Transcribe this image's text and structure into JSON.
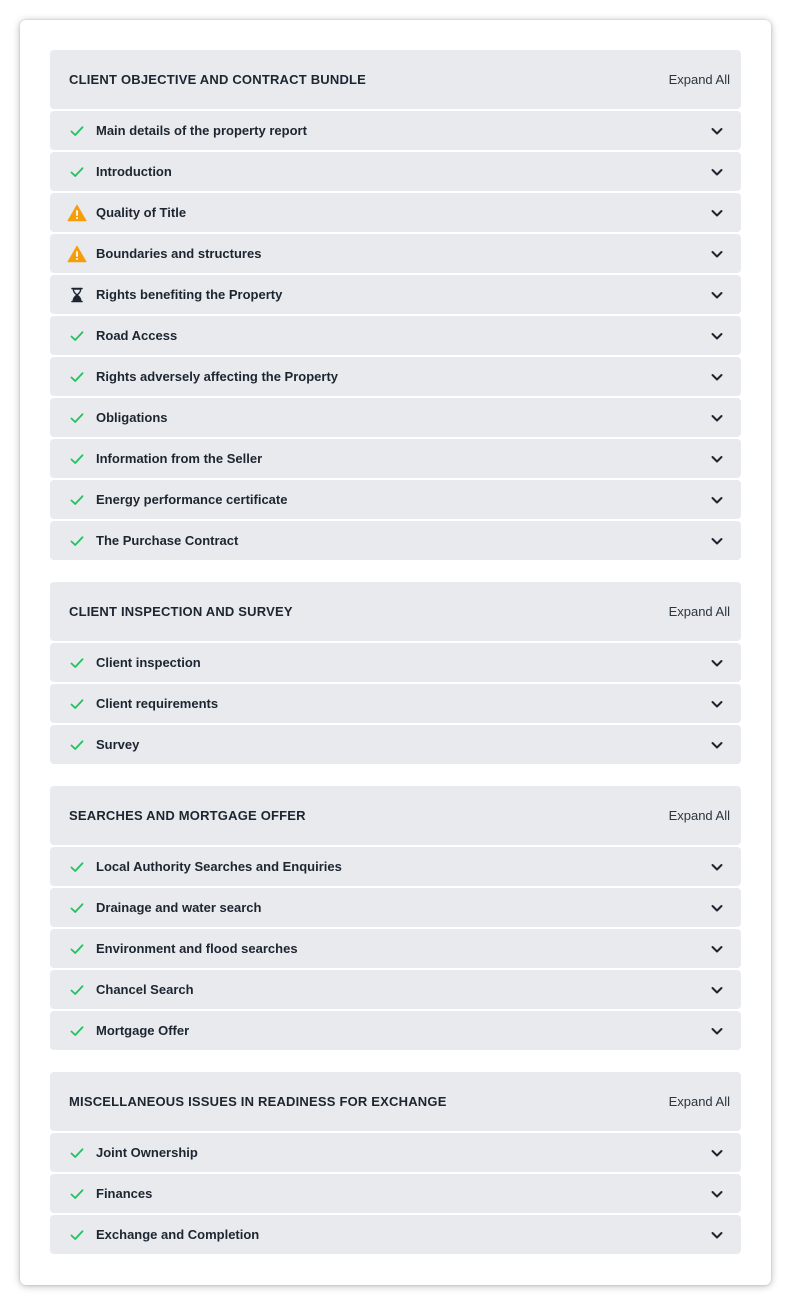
{
  "colors": {
    "check": "#22c35e",
    "warning": "#f59e0b",
    "pending": "#1c2530",
    "row_bg": "#e8eaee"
  },
  "sections": [
    {
      "title": "CLIENT OBJECTIVE AND CONTRACT BUNDLE",
      "expand_label": "Expand All",
      "items": [
        {
          "label": "Main details of the property report",
          "status_icon": "check-icon"
        },
        {
          "label": "Introduction",
          "status_icon": "check-icon"
        },
        {
          "label": "Quality of Title",
          "status_icon": "warning-icon"
        },
        {
          "label": "Boundaries and structures",
          "status_icon": "warning-icon"
        },
        {
          "label": "Rights benefiting the Property",
          "status_icon": "hourglass-icon"
        },
        {
          "label": "Road Access",
          "status_icon": "check-icon"
        },
        {
          "label": "Rights adversely affecting the Property",
          "status_icon": "check-icon"
        },
        {
          "label": "Obligations",
          "status_icon": "check-icon"
        },
        {
          "label": "Information from the Seller",
          "status_icon": "check-icon"
        },
        {
          "label": "Energy performance certificate",
          "status_icon": "check-icon"
        },
        {
          "label": "The Purchase Contract",
          "status_icon": "check-icon"
        }
      ]
    },
    {
      "title": "CLIENT INSPECTION AND SURVEY",
      "expand_label": "Expand All",
      "items": [
        {
          "label": "Client inspection",
          "status_icon": "check-icon"
        },
        {
          "label": "Client requirements",
          "status_icon": "check-icon"
        },
        {
          "label": "Survey",
          "status_icon": "check-icon"
        }
      ]
    },
    {
      "title": "SEARCHES AND MORTGAGE OFFER",
      "expand_label": "Expand All",
      "items": [
        {
          "label": "Local Authority Searches and Enquiries",
          "status_icon": "check-icon"
        },
        {
          "label": "Drainage and water search",
          "status_icon": "check-icon"
        },
        {
          "label": "Environment and flood searches",
          "status_icon": "check-icon"
        },
        {
          "label": "Chancel Search",
          "status_icon": "check-icon"
        },
        {
          "label": "Mortgage Offer",
          "status_icon": "check-icon"
        }
      ]
    },
    {
      "title": "MISCELLANEOUS ISSUES IN READINESS FOR EXCHANGE",
      "expand_label": "Expand All",
      "items": [
        {
          "label": "Joint Ownership",
          "status_icon": "check-icon"
        },
        {
          "label": "Finances",
          "status_icon": "check-icon"
        },
        {
          "label": "Exchange and Completion",
          "status_icon": "check-icon"
        }
      ]
    }
  ]
}
